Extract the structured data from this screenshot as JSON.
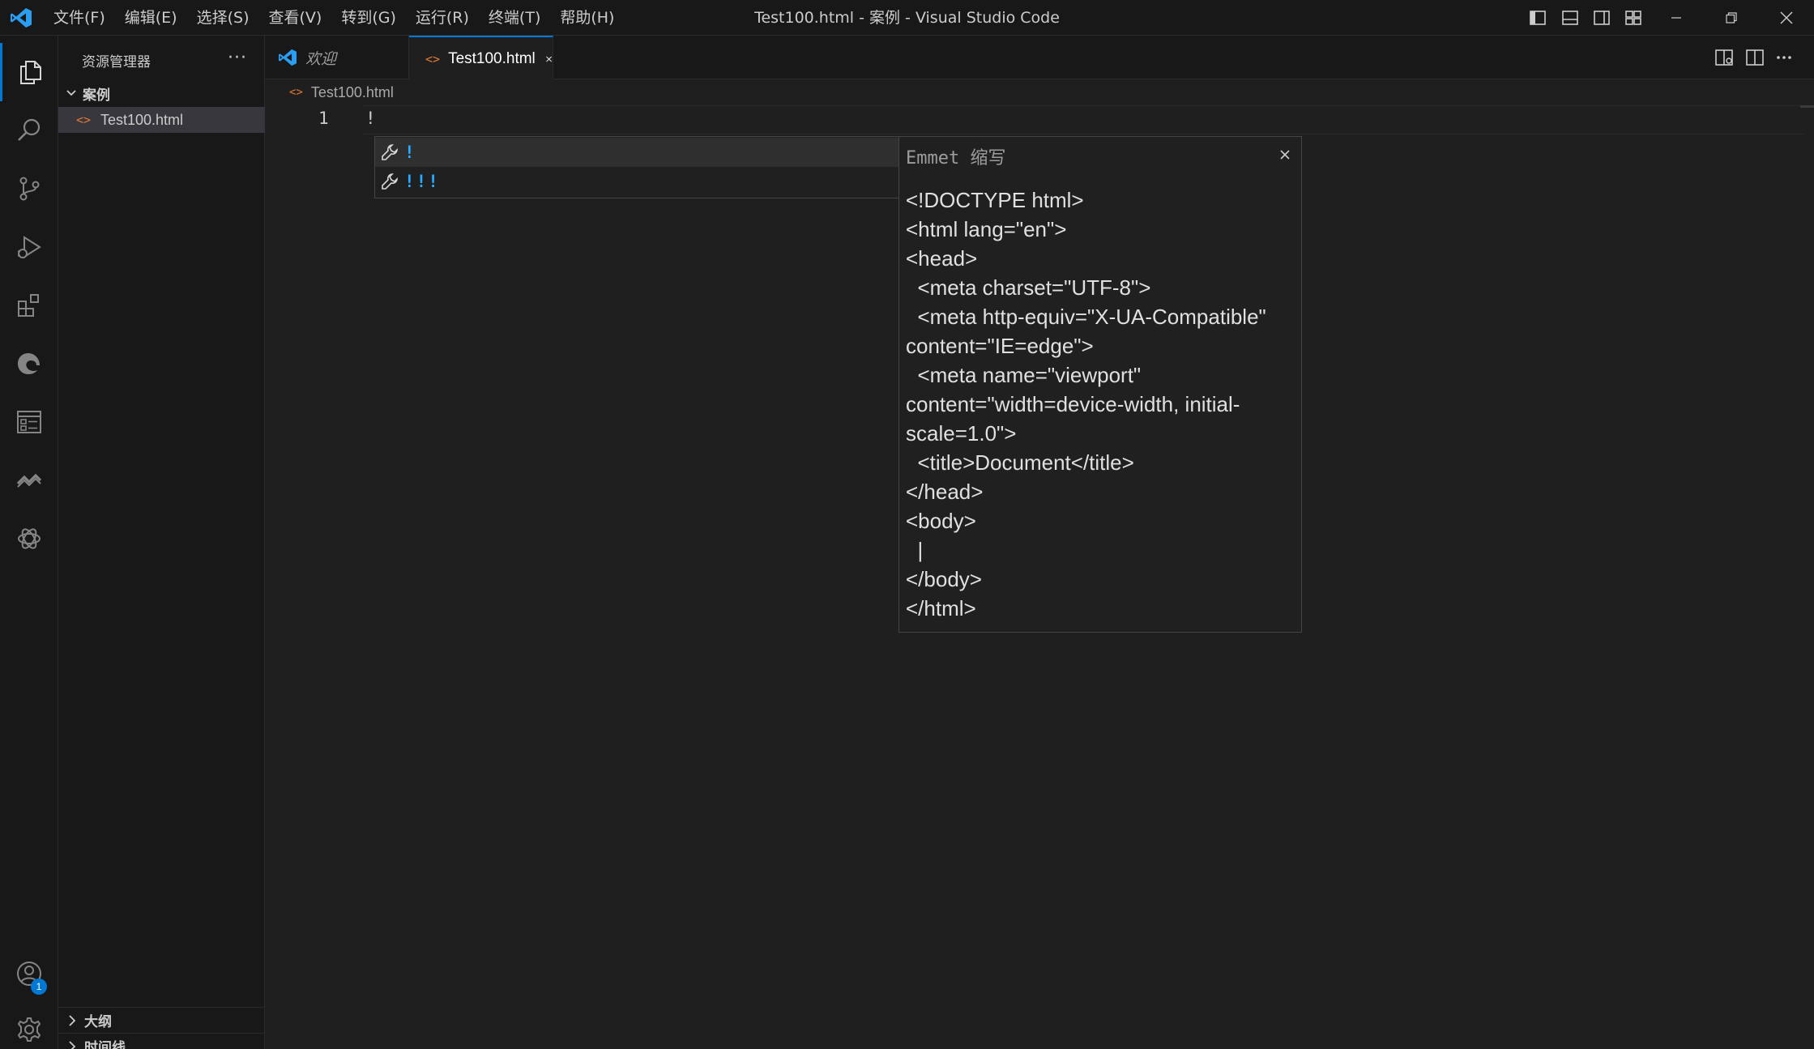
{
  "window": {
    "title": "Test100.html - 案例 - Visual Studio Code"
  },
  "menu": {
    "items": [
      "文件(F)",
      "编辑(E)",
      "选择(S)",
      "查看(V)",
      "转到(G)",
      "运行(R)",
      "终端(T)",
      "帮助(H)"
    ]
  },
  "activity_bar": {
    "items": [
      "explorer-icon",
      "search-icon",
      "source-control-icon",
      "run-debug-icon",
      "extensions-icon",
      "edge-icon",
      "remote-explorer-icon",
      "live-share-icon",
      "chatgpt-icon"
    ],
    "accounts_badge": "1"
  },
  "sidebar": {
    "title": "资源管理器",
    "more": "···",
    "folder": "案例",
    "file": "Test100.html",
    "sections": [
      "大纲",
      "时间线"
    ]
  },
  "tabs": [
    {
      "label": "欢迎",
      "italic": true
    },
    {
      "label": "Test100.html",
      "active": true
    }
  ],
  "breadcrumb": {
    "file": "Test100.html"
  },
  "editor": {
    "line_number": "1",
    "line_text": "!"
  },
  "suggest": {
    "items": [
      "!",
      "!!!"
    ]
  },
  "details": {
    "title": "Emmet 缩写",
    "doc": "<!DOCTYPE html>\n<html lang=\"en\">\n<head>\n\t<meta charset=\"UTF-8\">\n\t<meta http-equiv=\"X-UA-Compatible\" content=\"IE=edge\">\n\t<meta name=\"viewport\" content=\"width=device-width, initial-scale=1.0\">\n\t<title>Document</title>\n</head>\n<body>\n\t|\n</body>\n</html>"
  },
  "colors": {
    "accent": "#0078d4",
    "html_icon": "#e37933",
    "suggest_match": "#2aaaff",
    "background": "#1f1f1f",
    "chrome": "#181818"
  }
}
